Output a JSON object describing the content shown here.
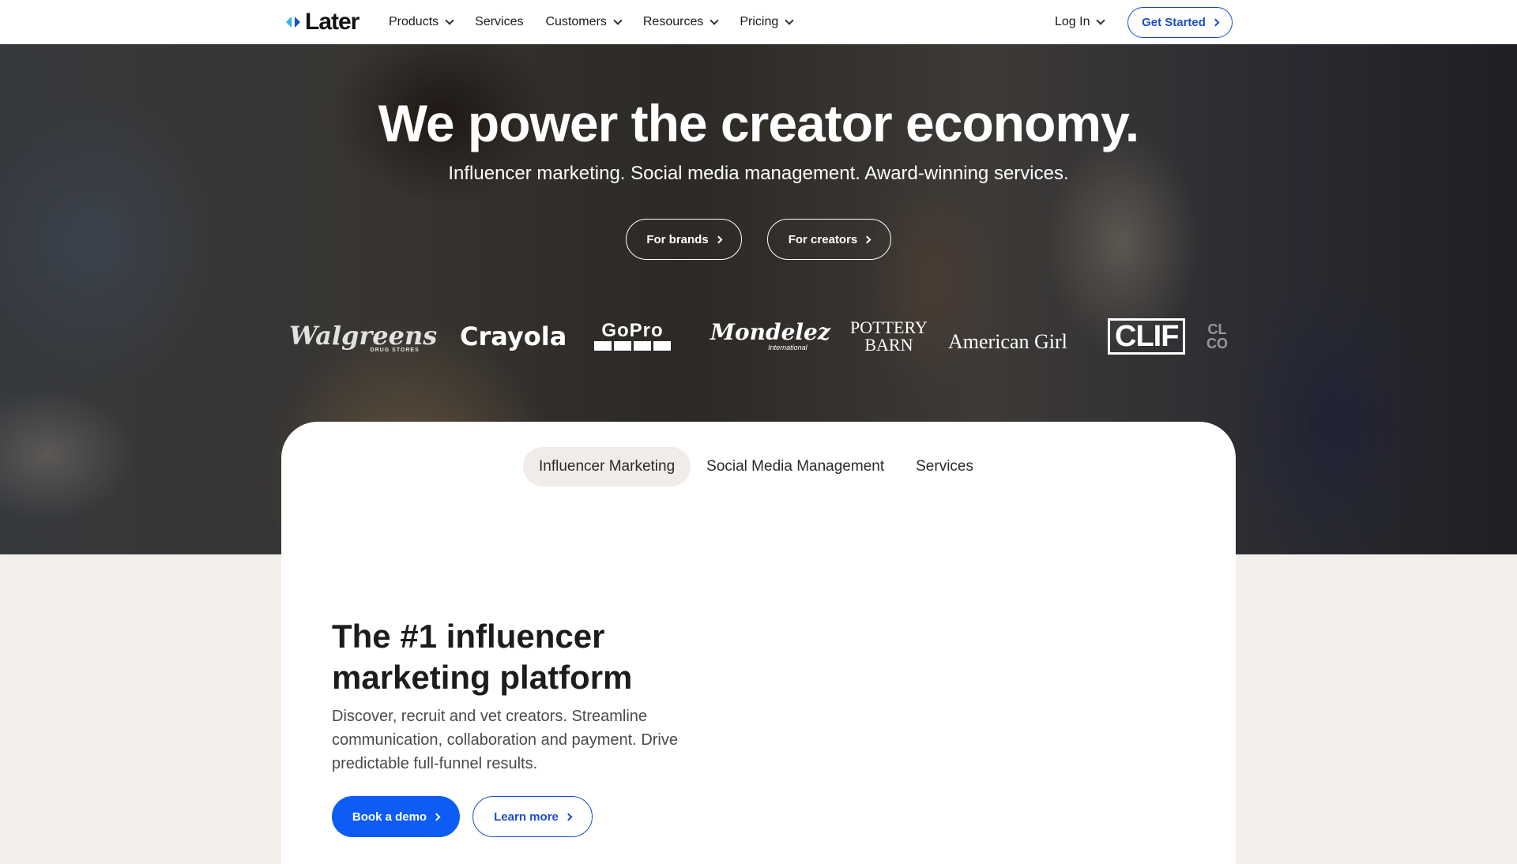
{
  "nav": {
    "logo_text": "Later",
    "items": [
      {
        "label": "Products",
        "dropdown": true
      },
      {
        "label": "Services",
        "dropdown": false
      },
      {
        "label": "Customers",
        "dropdown": true
      },
      {
        "label": "Resources",
        "dropdown": true
      },
      {
        "label": "Pricing",
        "dropdown": true
      }
    ],
    "login_label": "Log In",
    "get_started_label": "Get Started"
  },
  "hero": {
    "title": "We power the creator economy.",
    "subtitle": "Influencer marketing. Social media management. Award-winning services.",
    "brands_button": "For brands",
    "creators_button": "For creators",
    "brand_logos": [
      "Walgreens",
      "DRUG STORES",
      "Crayola",
      "GoPro",
      "Mondelez",
      "International",
      "POTTERY",
      "BARN",
      "American Girl",
      "CLIF",
      "CL",
      "CO"
    ]
  },
  "card": {
    "tabs": [
      "Influencer Marketing",
      "Social Media Management",
      "Services"
    ],
    "active_tab": "Influencer Marketing",
    "title_line1": "The #1 influencer",
    "title_line2": "marketing platform",
    "description": "Discover, recruit and vet creators. Streamline communication, collaboration and payment. Drive predictable full-funnel results.",
    "demo_button": "Book a demo",
    "learn_button": "Learn more"
  },
  "colors": {
    "brand_blue": "#0d5cf5",
    "outline_blue": "#1a4fc6",
    "logo_cyan": "#2ab6f0",
    "page_bg": "#f3efeb"
  }
}
